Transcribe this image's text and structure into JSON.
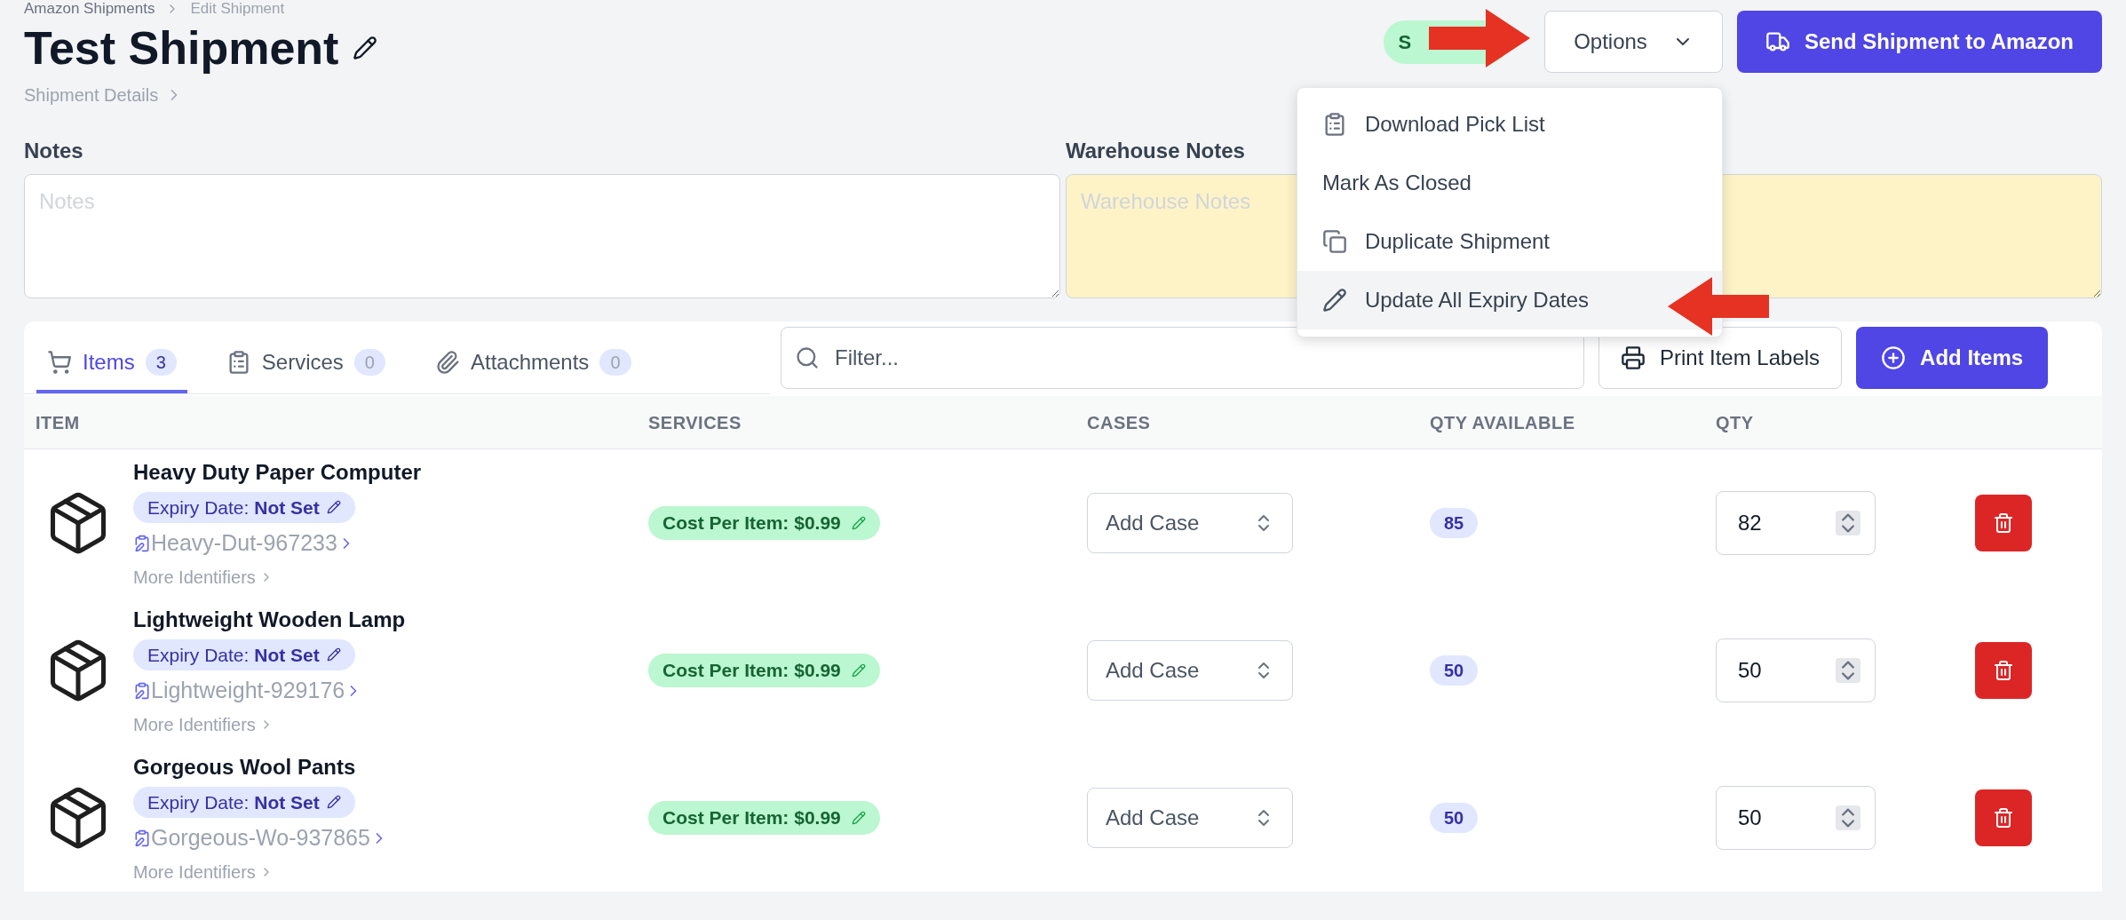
{
  "breadcrumb": [
    "Amazon Shipments",
    "Edit Shipment"
  ],
  "title": "Test Shipment",
  "details_link": "Shipment Details",
  "status_badge": "S",
  "options_button": "Options",
  "send_button": "Send Shipment to Amazon",
  "options_menu": {
    "expanded": true,
    "items": [
      {
        "label": "Download Pick List",
        "kind": "clipboard",
        "selected": false
      },
      {
        "label": "Mark As Closed",
        "kind": "plain",
        "selected": false
      },
      {
        "label": "Duplicate Shipment",
        "kind": "copy",
        "selected": false
      },
      {
        "label": "Update All Expiry Dates",
        "kind": "pencil",
        "selected": true
      }
    ]
  },
  "notes": {
    "label": "Notes",
    "placeholder": "Notes"
  },
  "warehouse_notes": {
    "label": "Warehouse Notes",
    "placeholder": "Warehouse Notes"
  },
  "tabs": [
    {
      "label": "Items",
      "count": "3",
      "kind": "cart",
      "selected": true
    },
    {
      "label": "Services",
      "count": "0",
      "kind": "clipboard",
      "selected": false
    },
    {
      "label": "Attachments",
      "count": "0",
      "kind": "paperclip",
      "selected": false
    }
  ],
  "filter": {
    "placeholder": "Filter..."
  },
  "print_button": "Print Item Labels",
  "add_button": "Add Items",
  "table": {
    "columns": [
      "ITEM",
      "SERVICES",
      "CASES",
      "QTY AVAILABLE",
      "QTY"
    ],
    "rows": [
      {
        "name": "Heavy Duty Paper Computer",
        "expiry_label": "Expiry Date:",
        "expiry_value": "Not Set",
        "identifier": "Heavy-Dut-967233",
        "more": "More Identifiers",
        "service": "Cost Per Item: $0.99",
        "case_placeholder": "Add Case",
        "qty_available": "85",
        "qty": "82"
      },
      {
        "name": "Lightweight Wooden Lamp",
        "expiry_label": "Expiry Date:",
        "expiry_value": "Not Set",
        "identifier": "Lightweight-929176",
        "more": "More Identifiers",
        "service": "Cost Per Item: $0.99",
        "case_placeholder": "Add Case",
        "qty_available": "50",
        "qty": "50"
      },
      {
        "name": "Gorgeous Wool Pants",
        "expiry_label": "Expiry Date:",
        "expiry_value": "Not Set",
        "identifier": "Gorgeous-Wo-937865",
        "more": "More Identifiers",
        "service": "Cost Per Item: $0.99",
        "case_placeholder": "Add Case",
        "qty_available": "50",
        "qty": "50"
      }
    ]
  },
  "annotation_arrows": [
    {
      "kind": "right"
    },
    {
      "kind": "left"
    }
  ]
}
